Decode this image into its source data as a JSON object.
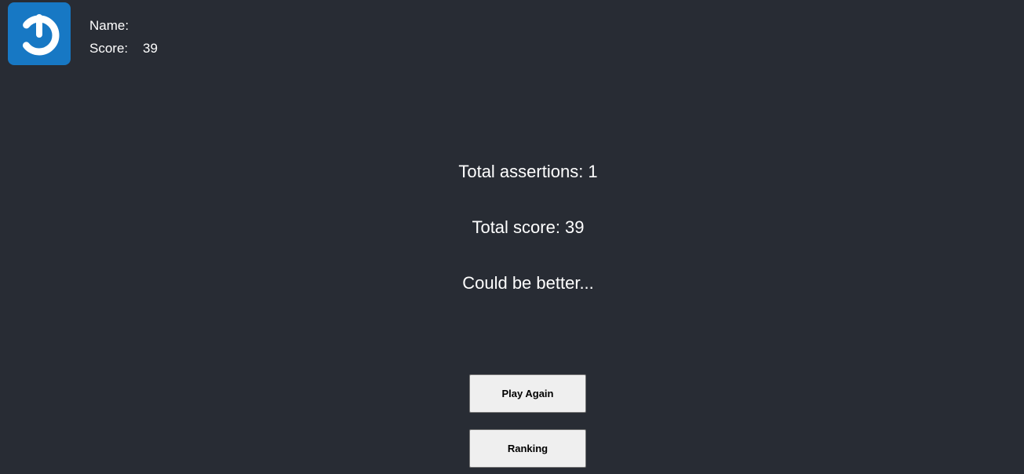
{
  "header": {
    "logo_icon": "power-icon",
    "logo_color": "#1778c4",
    "name_label": "Name:",
    "name_value": "",
    "score_label": "Score:",
    "score_value": "39"
  },
  "results": {
    "assertions_text": "Total assertions: 1",
    "score_text": "Total score: 39",
    "feedback_text": "Could be better..."
  },
  "actions": {
    "play_again_label": "Play Again",
    "ranking_label": "Ranking"
  },
  "colors": {
    "background": "#282c34",
    "text": "#ffffff",
    "button_bg": "#efefef"
  }
}
